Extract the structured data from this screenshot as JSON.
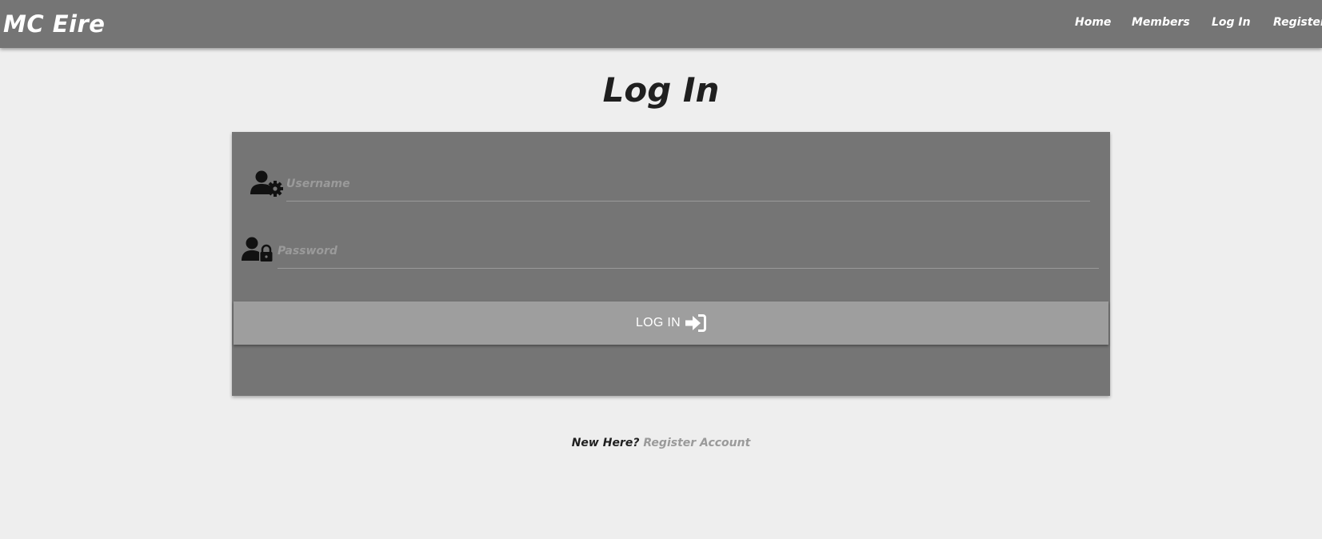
{
  "navbar": {
    "brand": "MC Eire",
    "links": [
      {
        "label": "Home"
      },
      {
        "label": "Members"
      },
      {
        "label": "Log In"
      },
      {
        "label": "Register"
      }
    ]
  },
  "page": {
    "title": "Log In"
  },
  "form": {
    "username": {
      "value": "",
      "placeholder": "Username",
      "icon": "user-gear-icon"
    },
    "password": {
      "value": "",
      "placeholder": "Password",
      "icon": "user-lock-icon"
    },
    "submit": {
      "label": "LOG IN",
      "icon": "sign-in-icon"
    }
  },
  "footer": {
    "prompt": "New Here?",
    "link_label": "Register Account"
  },
  "colors": {
    "navbar": "#757575",
    "background": "#eeeeee",
    "card": "#757575",
    "button": "#9e9e9e",
    "title": "#1f1f1f",
    "muted": "#9a9a9a"
  }
}
